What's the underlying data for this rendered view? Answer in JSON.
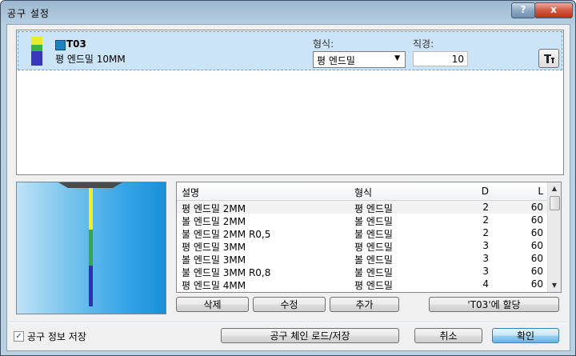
{
  "window": {
    "title": "공구 설정",
    "help_label": "?",
    "close_label": "x"
  },
  "tool_row": {
    "number": "T03",
    "name": "평 엔드밀 10MM",
    "type_label": "형식:",
    "type_value": "평 엔드밀",
    "diameter_label": "직경:",
    "diameter_value": "10",
    "icon": "tool-select-icon"
  },
  "table": {
    "headers": {
      "desc": "설명",
      "type": "형식",
      "d": "D",
      "l": "L"
    },
    "rows": [
      {
        "desc": "평 엔드밀 2MM",
        "type": "평 엔드밀",
        "d": "2",
        "l": "60"
      },
      {
        "desc": "볼 엔드밀 2MM",
        "type": "볼 엔드밀",
        "d": "2",
        "l": "60"
      },
      {
        "desc": "불 엔드밀 2MM R0,5",
        "type": "불 엔드밀",
        "d": "2",
        "l": "60"
      },
      {
        "desc": "평 엔드밀 3MM",
        "type": "평 엔드밀",
        "d": "3",
        "l": "60"
      },
      {
        "desc": "볼 엔드밀 3MM",
        "type": "볼 엔드밀",
        "d": "3",
        "l": "60"
      },
      {
        "desc": "불 엔드밀 3MM R0,8",
        "type": "불 엔드밀",
        "d": "3",
        "l": "60"
      },
      {
        "desc": "평 엔드밀 4MM",
        "type": "평 엔드밀",
        "d": "4",
        "l": "60"
      }
    ]
  },
  "buttons": {
    "delete": "삭제",
    "edit": "수정",
    "add": "추가",
    "assign": "'T03'에 할당",
    "chain": "공구 체인 로드/저장",
    "cancel": "취소",
    "ok": "확인"
  },
  "save_info": {
    "label": "공구 정보 저장",
    "checked": true,
    "check_mark": "✓"
  }
}
